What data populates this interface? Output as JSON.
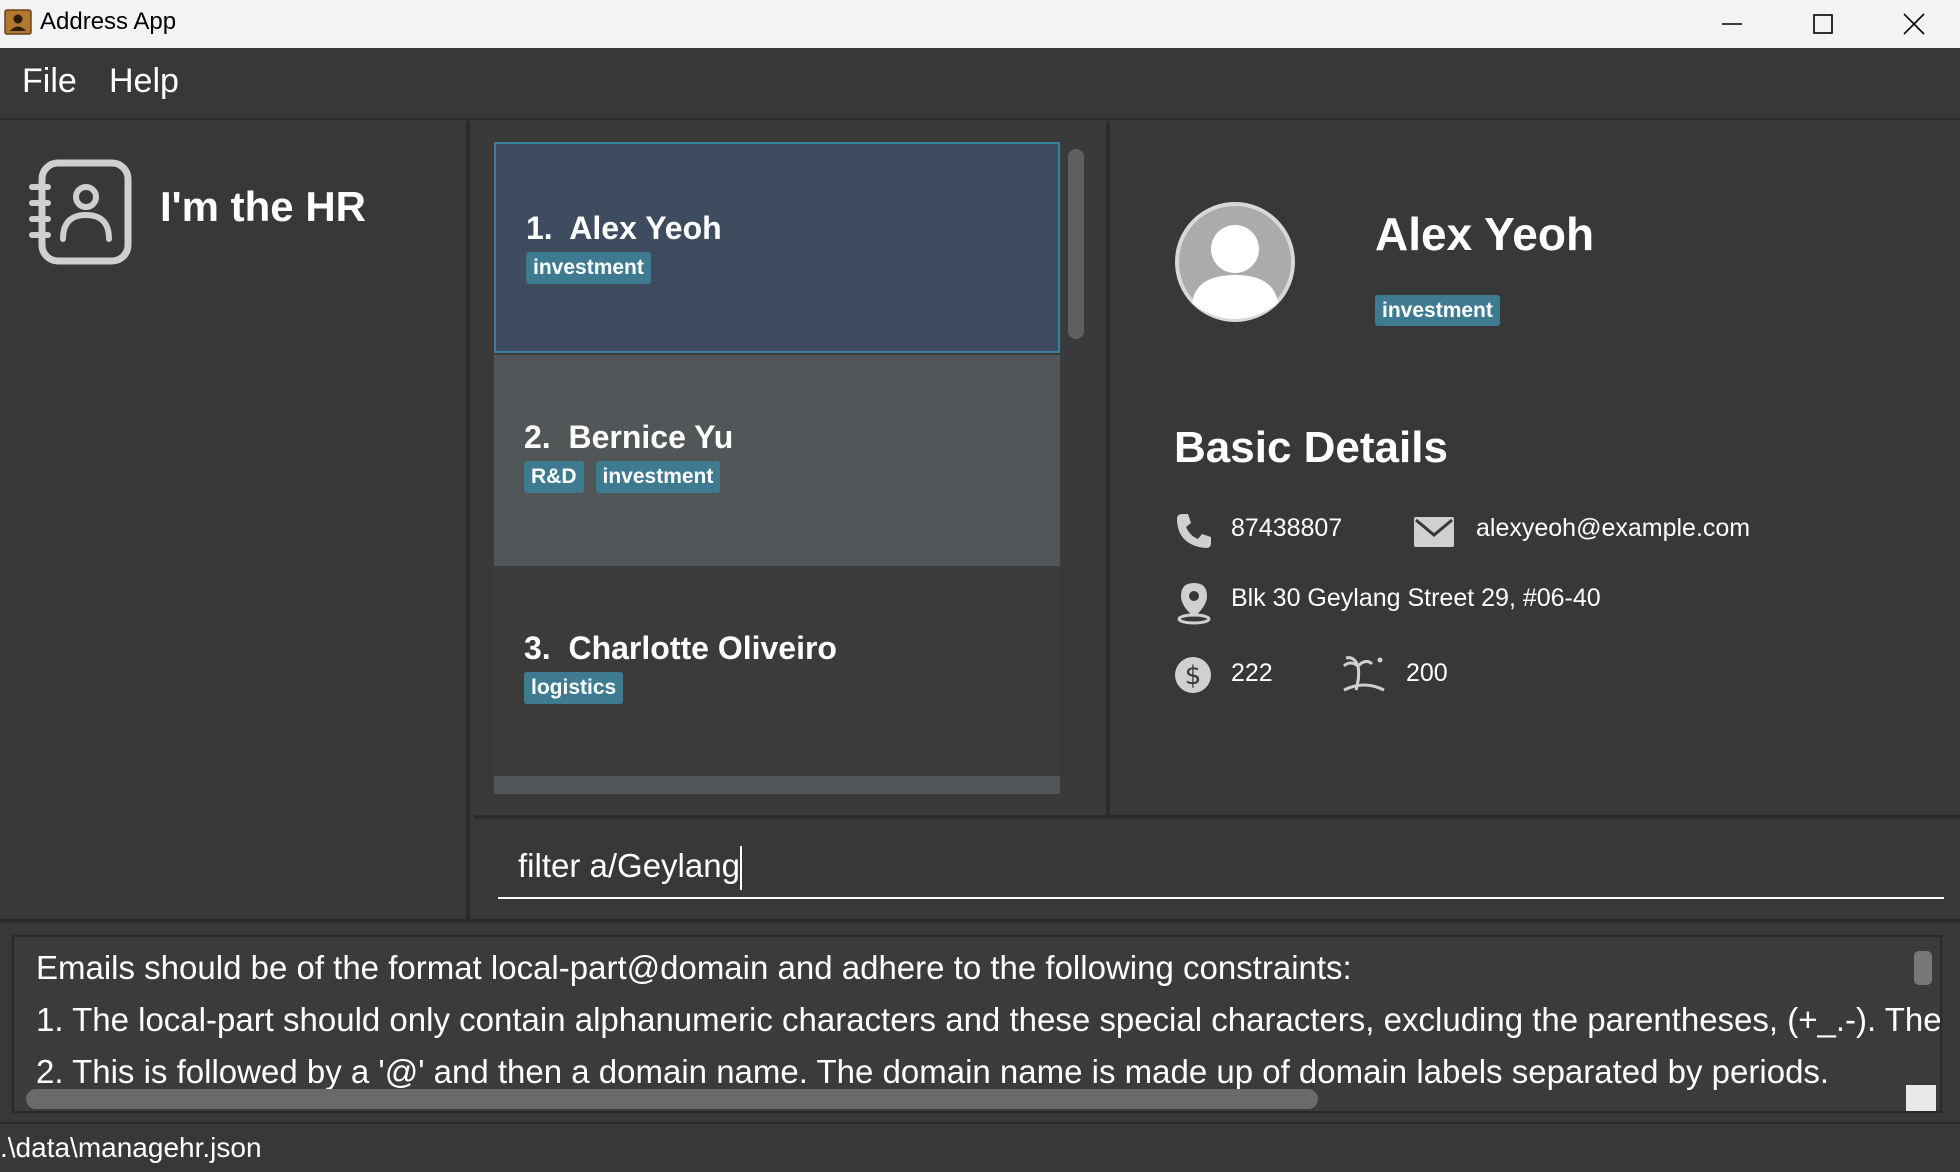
{
  "window": {
    "title": "Address App"
  },
  "menu": {
    "file": "File",
    "help": "Help"
  },
  "sidebar": {
    "app_name": "I'm the HR"
  },
  "persons": [
    {
      "index": "1.",
      "name": "Alex Yeoh",
      "tags": [
        "investment"
      ]
    },
    {
      "index": "2.",
      "name": "Bernice Yu",
      "tags": [
        "R&D",
        "investment"
      ]
    },
    {
      "index": "3.",
      "name": "Charlotte Oliveiro",
      "tags": [
        "logistics"
      ]
    }
  ],
  "detail": {
    "name": "Alex Yeoh",
    "tag": "investment",
    "section_title": "Basic Details",
    "phone": "87438807",
    "email": "alexyeoh@example.com",
    "address": "Blk 30 Geylang Street 29, #06-40",
    "salary": "222",
    "leave": "200",
    "icons": [
      "phone-icon",
      "email-icon",
      "location-icon",
      "dollar-icon",
      "beach-icon"
    ]
  },
  "command": {
    "value": "filter a/Geylang"
  },
  "result": {
    "lines": [
      "Emails should be of the format local-part@domain and adhere to the following constraints:",
      "1. The local-part should only contain alphanumeric characters and these special characters, excluding the parentheses, (+_.-). The",
      "2. This is followed by a '@' and then a domain name. The domain name is made up of domain labels separated by periods."
    ]
  },
  "status": {
    "path": ".\\data\\managehr.json"
  },
  "colors": {
    "background": "#383838",
    "tag": "#3e7b91",
    "selected_card": "#3f4b5e",
    "selected_border": "#3a7f9e"
  }
}
